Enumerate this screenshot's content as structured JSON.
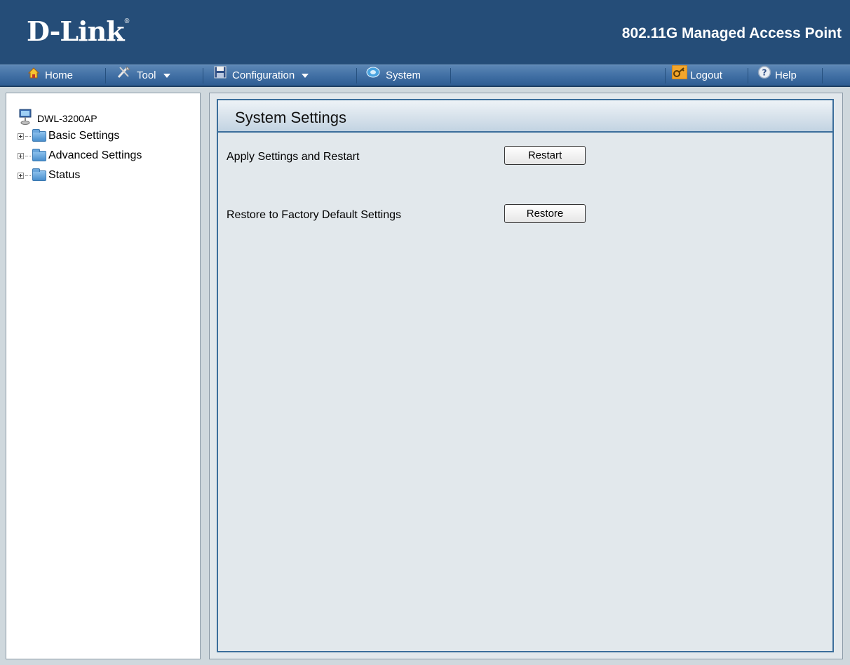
{
  "header": {
    "logo": "D-Link",
    "logo_mark": "®",
    "product_title": "802.11G Managed Access Point"
  },
  "menubar": {
    "items": [
      {
        "label": "Home",
        "icon": "home-icon"
      },
      {
        "label": "Tool",
        "icon": "tool-icon",
        "dropdown": true
      },
      {
        "label": "Configuration",
        "icon": "save-disk-icon",
        "dropdown": true
      },
      {
        "label": "System",
        "icon": "system-icon"
      },
      {
        "label": "Logout",
        "icon": "logout-key-icon"
      },
      {
        "label": "Help",
        "icon": "help-icon"
      }
    ]
  },
  "sidebar": {
    "root": {
      "label": "DWL-3200AP",
      "icon": "access-point-icon"
    },
    "nodes": [
      {
        "label": "Basic Settings"
      },
      {
        "label": "Advanced Settings"
      },
      {
        "label": "Status"
      }
    ]
  },
  "main": {
    "title": "System Settings",
    "rows": [
      {
        "label": "Apply Settings and Restart",
        "button": "Restart"
      },
      {
        "label": "Restore to Factory Default Settings",
        "button": "Restore"
      }
    ]
  },
  "colors": {
    "header_bg": "#254d78",
    "menubar_bg": "#3f6ea3",
    "panel_border": "#3b6e9b",
    "content_bg": "#e2e8ec"
  }
}
